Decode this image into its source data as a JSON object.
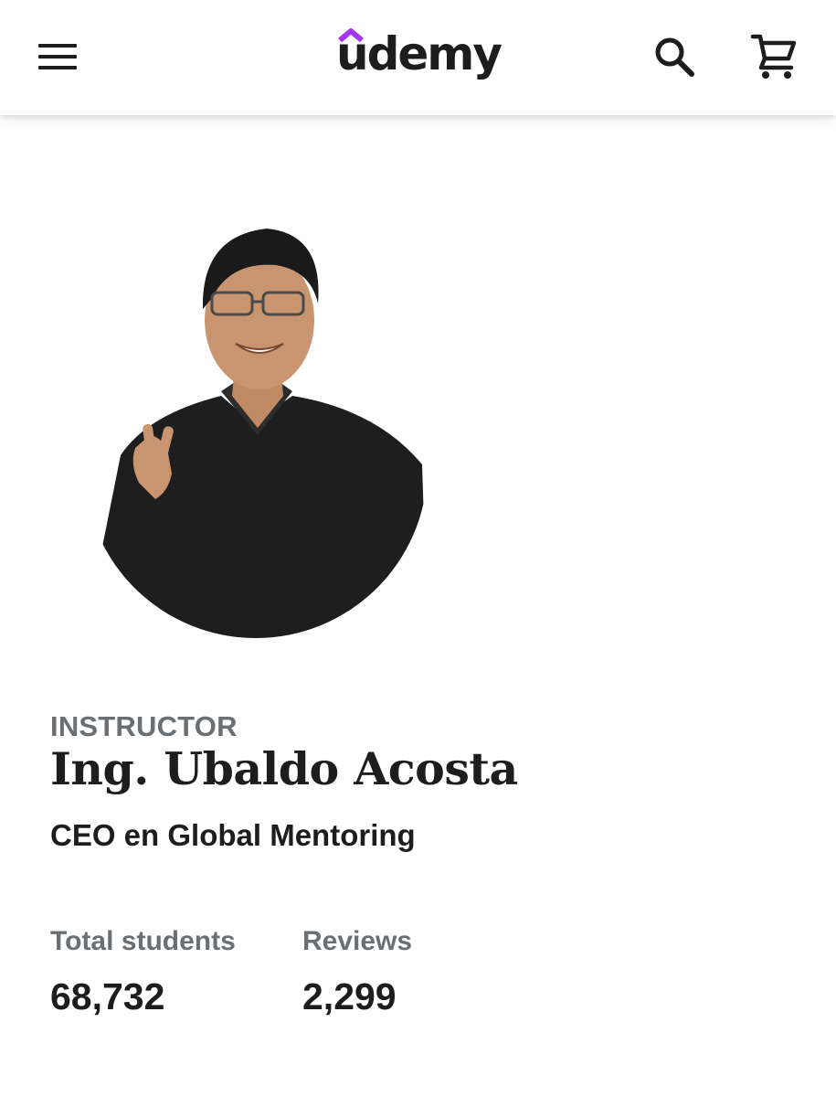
{
  "header": {
    "logo_text": "udemy",
    "brand_color": "#a435f0",
    "icons": [
      "menu-icon",
      "search-icon",
      "cart-icon"
    ]
  },
  "instructor": {
    "eyebrow": "INSTRUCTOR",
    "name": "Ing. Ubaldo Acosta",
    "headline": "CEO en Global Mentoring"
  },
  "stats": [
    {
      "label": "Total students",
      "value": "68,732"
    },
    {
      "label": "Reviews",
      "value": "2,299"
    }
  ]
}
